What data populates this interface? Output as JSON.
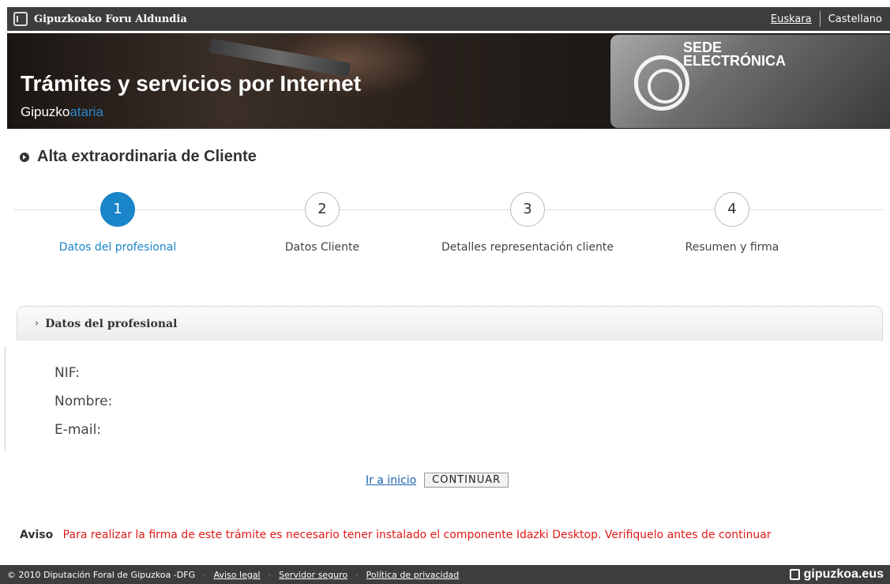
{
  "header": {
    "org_name": "Gipuzkoako Foru Aldundia",
    "languages": [
      "Euskara",
      "Castellano"
    ]
  },
  "banner": {
    "title": "Trámites y servicios por Internet",
    "subtitle_main": "Gipuzko",
    "subtitle_highlight": "ataria",
    "sede_line1": "SEDE",
    "sede_line2": "ELECTRÓNICA"
  },
  "page": {
    "title": "Alta extraordinaria de Cliente"
  },
  "stepper": {
    "active_step": 1,
    "steps": [
      {
        "number": "1",
        "label": "Datos del profesional"
      },
      {
        "number": "2",
        "label": "Datos Cliente"
      },
      {
        "number": "3",
        "label": "Detalles representación cliente"
      },
      {
        "number": "4",
        "label": "Resumen y firma"
      }
    ]
  },
  "panel": {
    "title": "Datos del profesional",
    "fields": [
      "NIF:",
      "Nombre:",
      "E-mail:"
    ]
  },
  "actions": {
    "home_link": "Ir a inicio",
    "continue_button": "CONTINUAR"
  },
  "notice": {
    "label": "Aviso",
    "message": "Para realizar la firma de este trámite es necesario tener instalado el componente Idazki Desktop. Verifiquelo antes de continuar"
  },
  "footer": {
    "copyright": "© 2010 Diputación Foral de Gipuzkoa -DFG",
    "links": [
      "Aviso legal",
      "Servidor seguro",
      "Política de privacidad"
    ],
    "brand": "gipuzkoa.eus"
  },
  "colors": {
    "accent_blue": "#1a85c9",
    "notice_red": "#e01919",
    "bar_dark": "#3d3d3d"
  }
}
